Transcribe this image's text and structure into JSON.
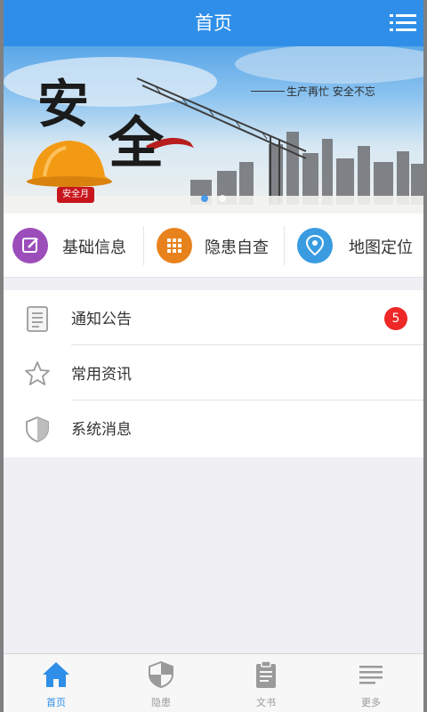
{
  "header": {
    "title": "首页",
    "menu_icon": "menu-icon"
  },
  "banner": {
    "slogan": "生产再忙  安全不忘",
    "big_char_1": "安",
    "big_char_2": "全",
    "stamp": "安全月",
    "slides": 2,
    "active_slide": 1
  },
  "quick_actions": [
    {
      "label": "基础信息",
      "icon": "edit-icon",
      "color": "#9b4dba"
    },
    {
      "label": "隐患自查",
      "icon": "grid-icon",
      "color": "#e8821c"
    },
    {
      "label": "地图定位",
      "icon": "location-pin-icon",
      "color": "#3a9be0"
    }
  ],
  "list": [
    {
      "label": "通知公告",
      "icon": "document-icon",
      "badge": "5"
    },
    {
      "label": "常用资讯",
      "icon": "star-icon"
    },
    {
      "label": "系统消息",
      "icon": "shield-icon"
    }
  ],
  "tabbar": [
    {
      "label": "首页",
      "icon": "home-icon",
      "active": true
    },
    {
      "label": "隐患",
      "icon": "shield-icon"
    },
    {
      "label": "文书",
      "icon": "clipboard-icon"
    },
    {
      "label": "更多",
      "icon": "more-lines-icon"
    }
  ],
  "colors": {
    "primary": "#2f8fe8",
    "badge": "#ee2727",
    "background": "#efeff4"
  }
}
